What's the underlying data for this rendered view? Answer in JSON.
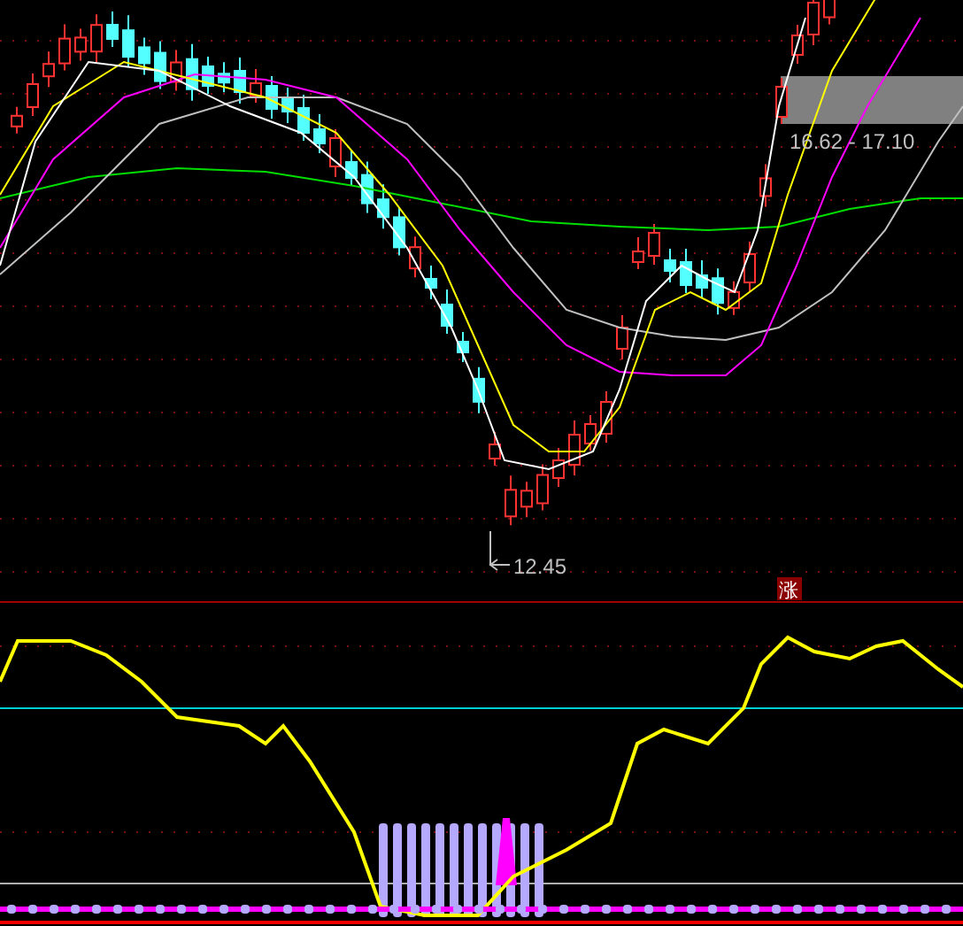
{
  "main_chart": {
    "low_label": "12.45",
    "range_label": "16.62 - 17.10",
    "badge": "涨"
  }
}
